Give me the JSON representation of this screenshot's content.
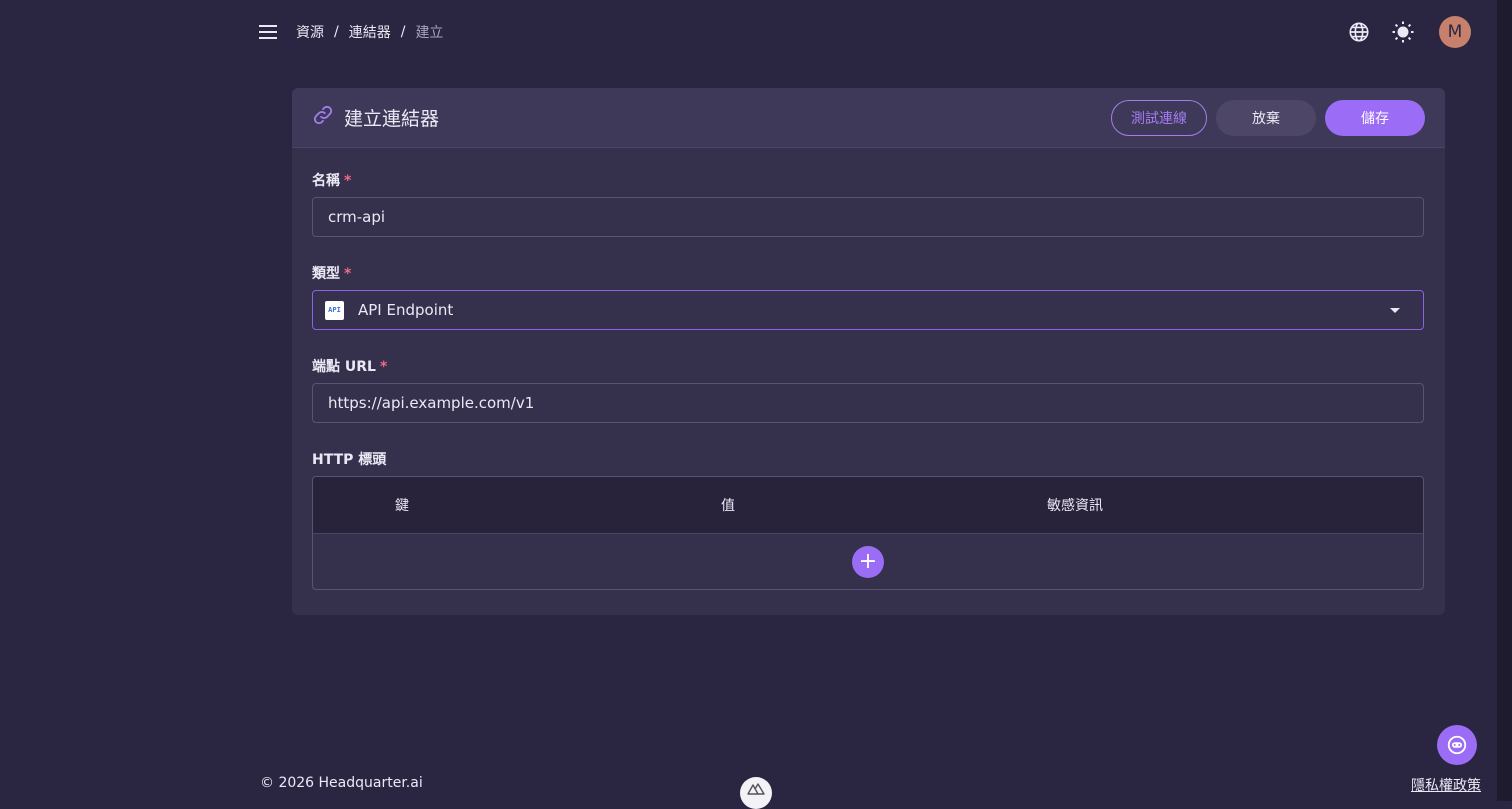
{
  "breadcrumb": {
    "items": [
      "資源",
      "連結器"
    ],
    "current": "建立",
    "separator": "/"
  },
  "user": {
    "avatar_initial": "M"
  },
  "card": {
    "title": "建立連結器",
    "test_button": "測試連線",
    "discard_button": "放棄",
    "save_button": "儲存"
  },
  "form": {
    "name": {
      "label": "名稱",
      "required_mark": "*",
      "value": "crm-api"
    },
    "type": {
      "label": "類型",
      "required_mark": "*",
      "value": "API Endpoint",
      "badge": "API"
    },
    "endpoint": {
      "label": "端點 URL",
      "required_mark": "*",
      "value": "https://api.example.com/v1"
    },
    "headers": {
      "label": "HTTP 標頭",
      "columns": [
        "鍵",
        "值",
        "敏感資訊"
      ],
      "add_symbol": "+"
    }
  },
  "footer": {
    "copyright": "© 2026 Headquarter.ai",
    "privacy": "隱私權政策"
  },
  "colors": {
    "background": "#2a2540",
    "card": "#35304b",
    "accent": "#9b6cf5",
    "required": "#f06a8a"
  }
}
